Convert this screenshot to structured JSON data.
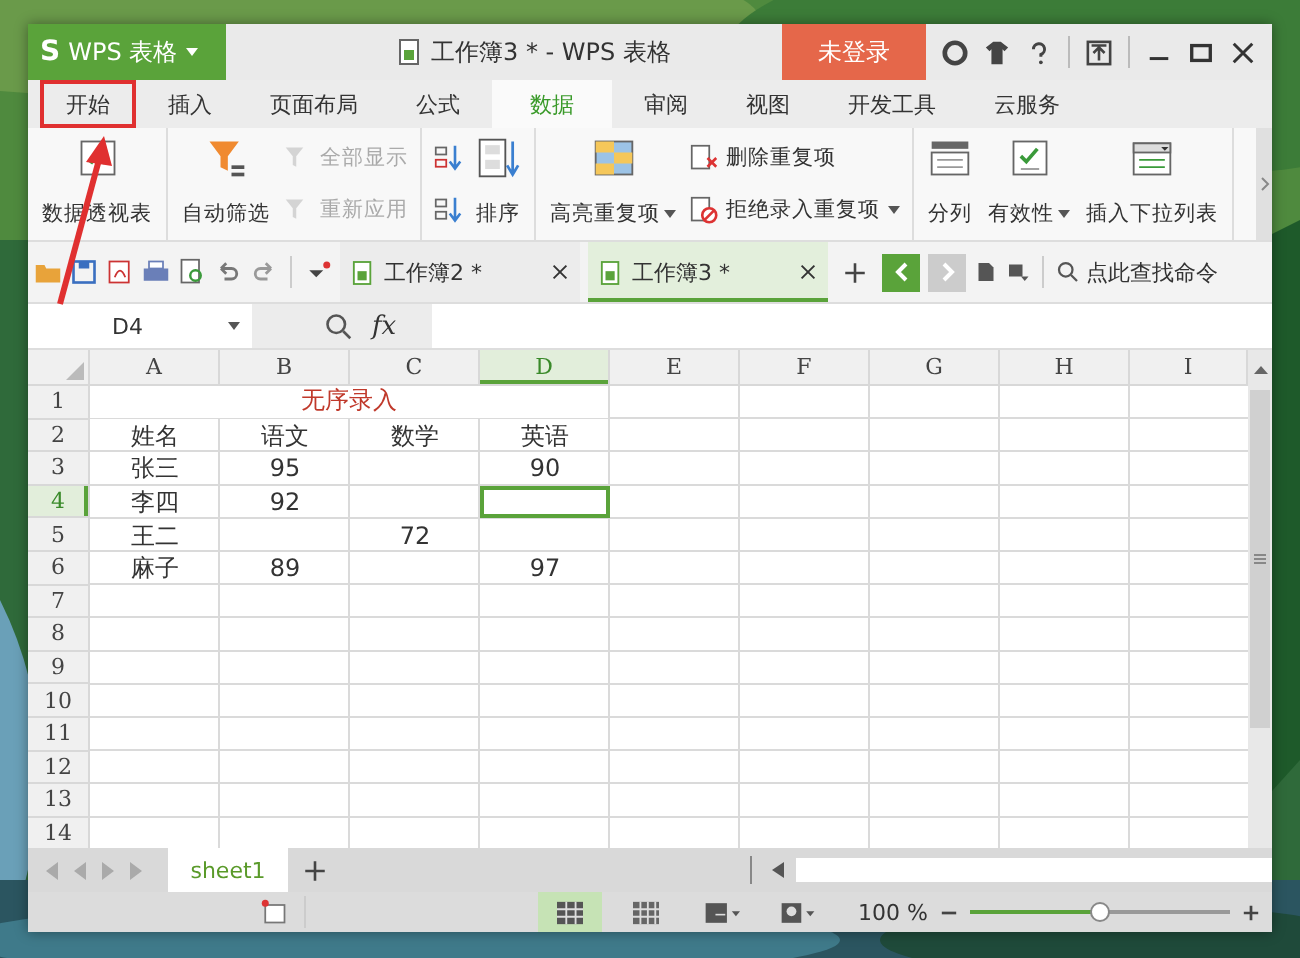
{
  "window": {
    "logo": "S",
    "app_name": "WPS 表格",
    "title": "工作簿3 * - WPS 表格",
    "login": "未登录"
  },
  "menu_tabs": [
    {
      "label": "开始",
      "selected": false,
      "annotated": true
    },
    {
      "label": "插入",
      "selected": false,
      "annotated": false
    },
    {
      "label": "页面布局",
      "selected": false,
      "annotated": false
    },
    {
      "label": "公式",
      "selected": false,
      "annotated": false
    },
    {
      "label": "数据",
      "selected": true,
      "annotated": false
    },
    {
      "label": "审阅",
      "selected": false,
      "annotated": false
    },
    {
      "label": "视图",
      "selected": false,
      "annotated": false
    },
    {
      "label": "开发工具",
      "selected": false,
      "annotated": false
    },
    {
      "label": "云服务",
      "selected": false,
      "annotated": false
    }
  ],
  "ribbon": [
    [
      {
        "kind": "large",
        "label": "数据透视表",
        "disabled": false,
        "menu": false
      }
    ],
    [
      {
        "kind": "large",
        "label": "自动筛选",
        "disabled": false,
        "menu": false
      },
      {
        "kind": "small",
        "label": "全部显示",
        "disabled": true,
        "menu": false
      },
      {
        "kind": "small",
        "label": "重新应用",
        "disabled": true,
        "menu": false
      }
    ],
    [
      {
        "kind": "icon",
        "disabled": false,
        "menu": false
      },
      {
        "kind": "icon",
        "disabled": false,
        "menu": false
      },
      {
        "kind": "large",
        "label": "排序",
        "disabled": false,
        "menu": false
      }
    ],
    [
      {
        "kind": "large",
        "label": "高亮重复项",
        "disabled": false,
        "menu": true
      },
      {
        "kind": "small",
        "label": "删除重复项",
        "disabled": false,
        "menu": false
      },
      {
        "kind": "small",
        "label": "拒绝录入重复项",
        "disabled": false,
        "menu": true
      }
    ],
    [
      {
        "kind": "large",
        "label": "分列",
        "disabled": false,
        "menu": false
      },
      {
        "kind": "large",
        "label": "有效性",
        "disabled": false,
        "menu": true
      },
      {
        "kind": "large",
        "label": "插入下拉列表",
        "disabled": false,
        "menu": false
      }
    ]
  ],
  "doc_tabs": [
    {
      "label": "工作簿2 *",
      "selected": false
    },
    {
      "label": "工作簿3 *",
      "selected": true
    }
  ],
  "command_search": {
    "placeholder": "点此查找命令"
  },
  "formula_bar": {
    "name_box": "D4",
    "fx": "fx"
  },
  "sheet": {
    "columns": [
      {
        "label": "A",
        "selected": false
      },
      {
        "label": "B",
        "selected": false
      },
      {
        "label": "C",
        "selected": false
      },
      {
        "label": "D",
        "selected": true
      },
      {
        "label": "E",
        "selected": false
      },
      {
        "label": "F",
        "selected": false
      },
      {
        "label": "G",
        "selected": false
      },
      {
        "label": "H",
        "selected": false
      },
      {
        "label": "I",
        "selected": false
      }
    ],
    "rows": [
      {
        "label": "1",
        "selected": false,
        "title": "无序录入"
      },
      {
        "label": "2",
        "selected": false,
        "cells": [
          "姓名",
          "语文",
          "数学",
          "英语"
        ]
      },
      {
        "label": "3",
        "selected": false,
        "cells": [
          "张三",
          "95",
          null,
          "90"
        ]
      },
      {
        "label": "4",
        "selected": true,
        "cells": [
          "李四",
          "92",
          null,
          null
        ]
      },
      {
        "label": "5",
        "selected": false,
        "cells": [
          "王二",
          null,
          "72",
          null
        ]
      },
      {
        "label": "6",
        "selected": false,
        "cells": [
          "麻子",
          "89",
          null,
          "97"
        ]
      },
      {
        "label": "7",
        "selected": false
      },
      {
        "label": "8",
        "selected": false
      },
      {
        "label": "9",
        "selected": false
      },
      {
        "label": "10",
        "selected": false
      },
      {
        "label": "11",
        "selected": false
      },
      {
        "label": "12",
        "selected": false
      },
      {
        "label": "13",
        "selected": false
      },
      {
        "label": "14",
        "selected": false
      }
    ]
  },
  "sheet_tabs": [
    {
      "label": "sheet1",
      "selected": true
    }
  ],
  "status_bar": {
    "view_buttons": [
      {
        "kind": "normal",
        "selected": true
      },
      {
        "kind": "page-break",
        "selected": false
      },
      {
        "kind": "layout",
        "selected": false
      },
      {
        "kind": "eye",
        "selected": false
      }
    ],
    "zoom": "100 %",
    "zoom_slider": {
      "level": 0.5
    }
  }
}
